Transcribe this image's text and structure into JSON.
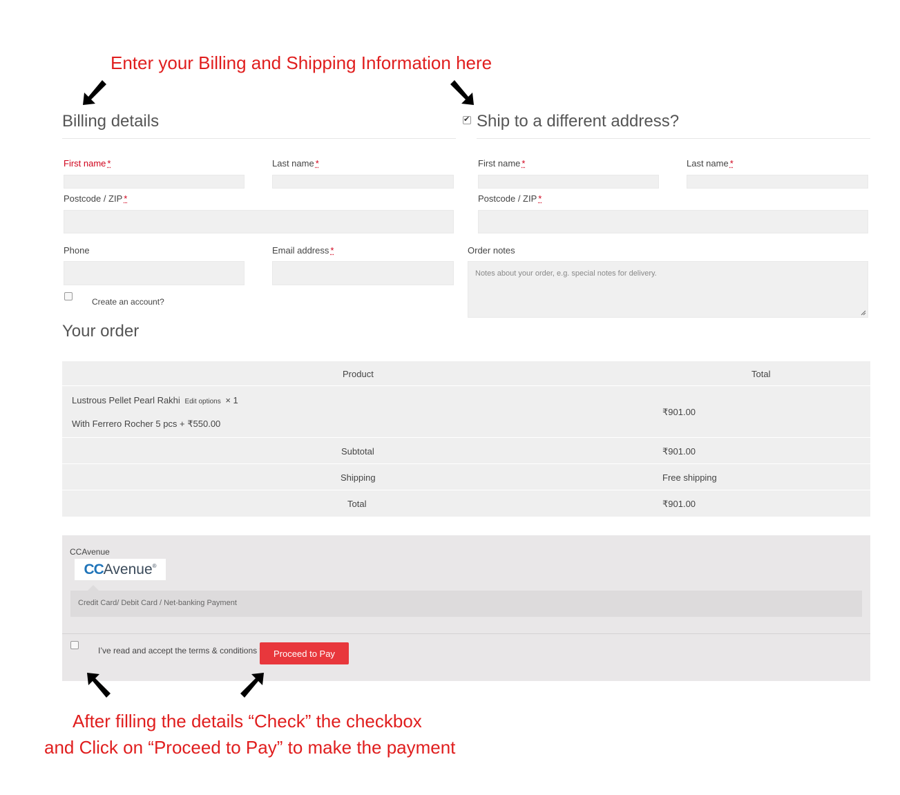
{
  "annotations": {
    "top": "Enter your Billing and Shipping Information here",
    "bottom_line1": "After filling the details “Check” the checkbox",
    "bottom_line2": "and Click on “Proceed to Pay” to make the payment"
  },
  "billing": {
    "title": "Billing details",
    "first_name_label": "First name",
    "last_name_label": "Last name",
    "postcode_label": "Postcode / ZIP",
    "phone_label": "Phone",
    "email_label": "Email address",
    "required_mark": "*",
    "create_account_label": "Create an account?"
  },
  "shipping": {
    "title": "Ship to a different address?",
    "checked": true,
    "first_name_label": "First name",
    "last_name_label": "Last name",
    "postcode_label": "Postcode / ZIP",
    "order_notes_label": "Order notes",
    "order_notes_placeholder": "Notes about your order, e.g. special notes for delivery."
  },
  "order": {
    "title": "Your order",
    "headers": {
      "product": "Product",
      "total": "Total"
    },
    "item": {
      "name": "Lustrous Pellet Pearl Rakhi",
      "edit_link": "Edit options",
      "quantity": "× 1",
      "option": "With Ferrero Rocher 5 pcs + ₹550.00",
      "total": "₹901.00"
    },
    "subtotal_label": "Subtotal",
    "subtotal_value": "₹901.00",
    "shipping_label": "Shipping",
    "shipping_value": "Free shipping",
    "total_label": "Total",
    "total_value": "₹901.00"
  },
  "payment": {
    "method_label": "CCAvenue",
    "logo_cc": "CC",
    "logo_avenue": "Avenue",
    "logo_reg": "®",
    "description": "Credit Card/ Debit Card / Net-banking Payment",
    "terms_label": "I’ve read and accept the terms & conditions",
    "terms_required": "*",
    "proceed_label": "Proceed to Pay"
  },
  "colors": {
    "annotation_red": "#e01e1e",
    "proceed_button": "#e8373c",
    "ccavenue_blue": "#1f74b9"
  }
}
